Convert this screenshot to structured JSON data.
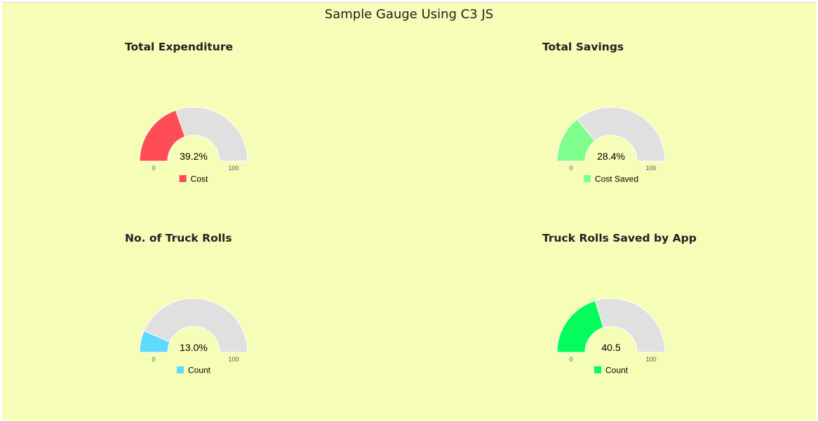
{
  "page": {
    "title": "Sample Gauge Using C3 JS"
  },
  "chart_data": [
    {
      "type": "gauge",
      "title": "Total Expenditure",
      "value": 39.2,
      "display": "39.2%",
      "min": 0,
      "max": 100,
      "min_label": "0",
      "max_label": "100",
      "series": "Cost",
      "color": "#ff4d57"
    },
    {
      "type": "gauge",
      "title": "Total Savings",
      "value": 28.4,
      "display": "28.4%",
      "min": 0,
      "max": 100,
      "min_label": "0",
      "max_label": "100",
      "series": "Cost Saved",
      "color": "#7ffe8e"
    },
    {
      "type": "gauge",
      "title": "No. of Truck Rolls",
      "value": 13.0,
      "display": "13.0%",
      "min": 0,
      "max": 100,
      "min_label": "0",
      "max_label": "100",
      "series": "Count",
      "color": "#5ddafd"
    },
    {
      "type": "gauge",
      "title": "Truck Rolls Saved by App",
      "value": 40.5,
      "display": "40.5",
      "min": 0,
      "max": 100,
      "min_label": "0",
      "max_label": "100",
      "series": "Count",
      "color": "#04fc5d"
    }
  ],
  "colors": {
    "background": "#f5fdb7",
    "track": "#e0e0e0"
  }
}
